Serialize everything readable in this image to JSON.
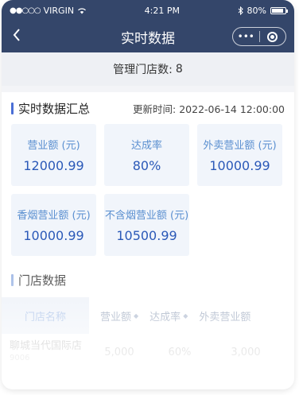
{
  "status_bar": {
    "signal": "●●○○○",
    "carrier": "VIRGIN",
    "time": "4:21 PM",
    "battery": "80%"
  },
  "nav": {
    "back_icon": "chevron-left-icon",
    "title": "实时数据",
    "more": "•••",
    "target_icon": "target-icon"
  },
  "store_count": {
    "label": "管理门店数:",
    "value": "8"
  },
  "realtime": {
    "title": "实时数据汇总",
    "update_label": "更新时间:",
    "update_time": "2022-06-14 12:00:00",
    "cards": [
      {
        "label": "营业额 (元)",
        "value": "12000.99"
      },
      {
        "label": "达成率",
        "value": "80%"
      },
      {
        "label": "外卖营业额 (元)",
        "value": "10000.99"
      },
      {
        "label": "香烟营业额 (元)",
        "value": "10000.99"
      },
      {
        "label": "不含烟营业额 (元)",
        "value": "10500.99"
      }
    ]
  },
  "store_data": {
    "title": "门店数据",
    "columns": [
      "门店名称",
      "营业额",
      "达成率",
      "外卖营业额"
    ],
    "sort_icon": "◆",
    "rows": [
      {
        "name": "聊城当代国际店",
        "code": "9006",
        "revenue": "5,000",
        "rate": "60%",
        "takeout": "3,000"
      }
    ]
  },
  "colors": {
    "nav_bg": "#34466a",
    "accent": "#4a6fd6",
    "value": "#2b59b8",
    "label": "#5a8fd0",
    "card_bg": "#f1f5fb"
  }
}
